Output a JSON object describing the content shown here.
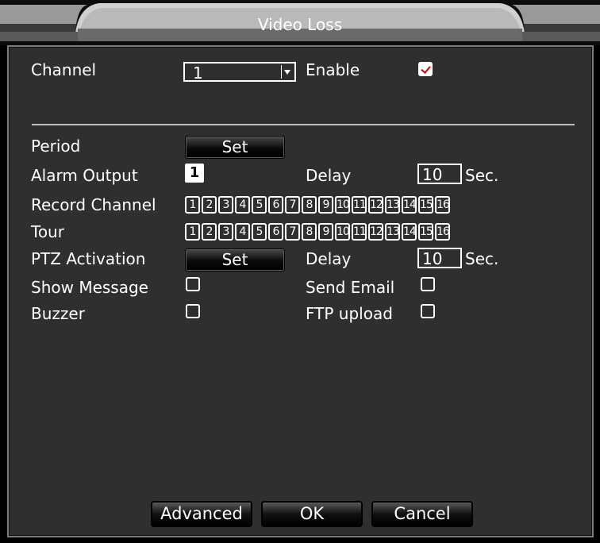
{
  "window": {
    "title": "Video Loss"
  },
  "channel": {
    "label": "Channel",
    "value": "1"
  },
  "enable": {
    "label": "Enable",
    "checked": true
  },
  "period": {
    "label": "Period",
    "button": "Set"
  },
  "alarm_output": {
    "label": "Alarm Output",
    "value": "1"
  },
  "delay1": {
    "label": "Delay",
    "value": "10",
    "unit": "Sec."
  },
  "record_channel": {
    "label": "Record Channel",
    "channels": [
      "1",
      "2",
      "3",
      "4",
      "5",
      "6",
      "7",
      "8",
      "9",
      "10",
      "11",
      "12",
      "13",
      "14",
      "15",
      "16"
    ]
  },
  "tour": {
    "label": "Tour",
    "channels": [
      "1",
      "2",
      "3",
      "4",
      "5",
      "6",
      "7",
      "8",
      "9",
      "10",
      "11",
      "12",
      "13",
      "14",
      "15",
      "16"
    ]
  },
  "ptz": {
    "label": "PTZ Activation",
    "button": "Set"
  },
  "delay2": {
    "label": "Delay",
    "value": "10",
    "unit": "Sec."
  },
  "show_message": {
    "label": "Show Message",
    "checked": false
  },
  "send_email": {
    "label": "Send Email",
    "checked": false
  },
  "buzzer": {
    "label": "Buzzer",
    "checked": false
  },
  "ftp_upload": {
    "label": "FTP upload",
    "checked": false
  },
  "footer": {
    "advanced": "Advanced",
    "ok": "OK",
    "cancel": "Cancel"
  },
  "colors": {
    "panel": "#2f2f2f",
    "check_mark": "#dd0000",
    "text": "#ffffff"
  }
}
